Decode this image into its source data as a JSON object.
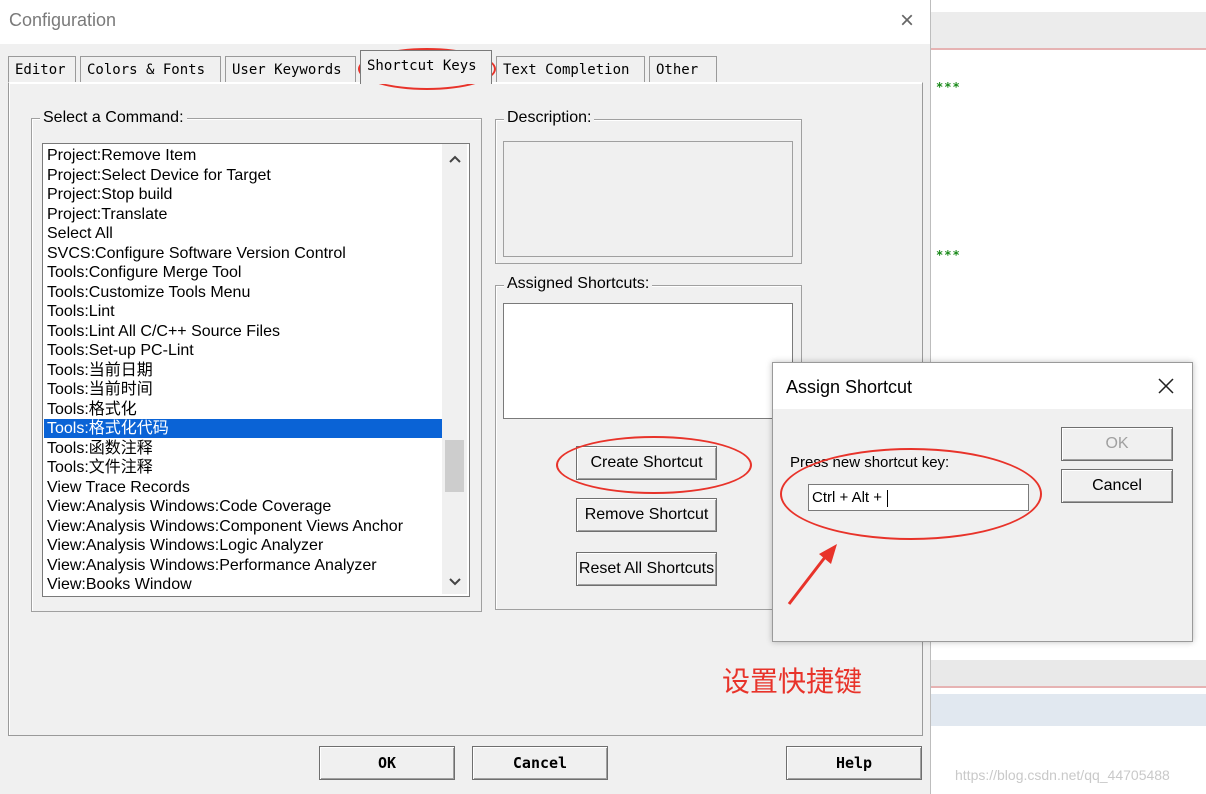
{
  "window": {
    "title": "Configuration",
    "close_icon": "×"
  },
  "tabs": [
    {
      "label": "Editor"
    },
    {
      "label": "Colors & Fonts"
    },
    {
      "label": "User Keywords"
    },
    {
      "label": "Shortcut Keys",
      "active": true
    },
    {
      "label": "Text Completion"
    },
    {
      "label": "Other"
    }
  ],
  "select_command": {
    "label": "Select a Command:",
    "items": [
      "Project:Remove Item",
      "Project:Select Device for Target",
      "Project:Stop build",
      "Project:Translate",
      "Select All",
      "SVCS:Configure Software Version Control",
      "Tools:Configure Merge Tool",
      "Tools:Customize Tools Menu",
      "Tools:Lint",
      "Tools:Lint All C/C++ Source Files",
      "Tools:Set-up PC-Lint",
      "Tools:当前日期",
      "Tools:当前时间",
      "Tools:格式化",
      "Tools:格式化代码",
      "Tools:函数注释",
      "Tools:文件注释",
      "View Trace Records",
      "View:Analysis Windows:Code Coverage",
      "View:Analysis Windows:Component Views Anchor",
      "View:Analysis Windows:Logic Analyzer",
      "View:Analysis Windows:Performance Analyzer",
      "View:Books Window"
    ],
    "selected_index": 14
  },
  "description": {
    "label": "Description:"
  },
  "assigned_shortcuts": {
    "label": "Assigned Shortcuts:"
  },
  "buttons": {
    "create_shortcut": "Create Shortcut",
    "remove_shortcut": "Remove Shortcut",
    "reset_all_shortcuts": "Reset All Shortcuts",
    "ok": "OK",
    "cancel": "Cancel",
    "help": "Help"
  },
  "assign_dialog": {
    "title": "Assign Shortcut",
    "prompt": "Press new shortcut key:",
    "input_value": "Ctrl + Alt + ",
    "ok": "OK",
    "cancel": "Cancel"
  },
  "annotation": {
    "text": "设置快捷键",
    "color": "#e8332a"
  },
  "background_editor": {
    "comment_marks": [
      "***",
      "***"
    ]
  },
  "watermark": "https://blog.csdn.net/qq_44705488",
  "colors": {
    "selection": "#0a63d6",
    "window_bg": "#f0f0f0",
    "annotation_red": "#e8332a"
  }
}
